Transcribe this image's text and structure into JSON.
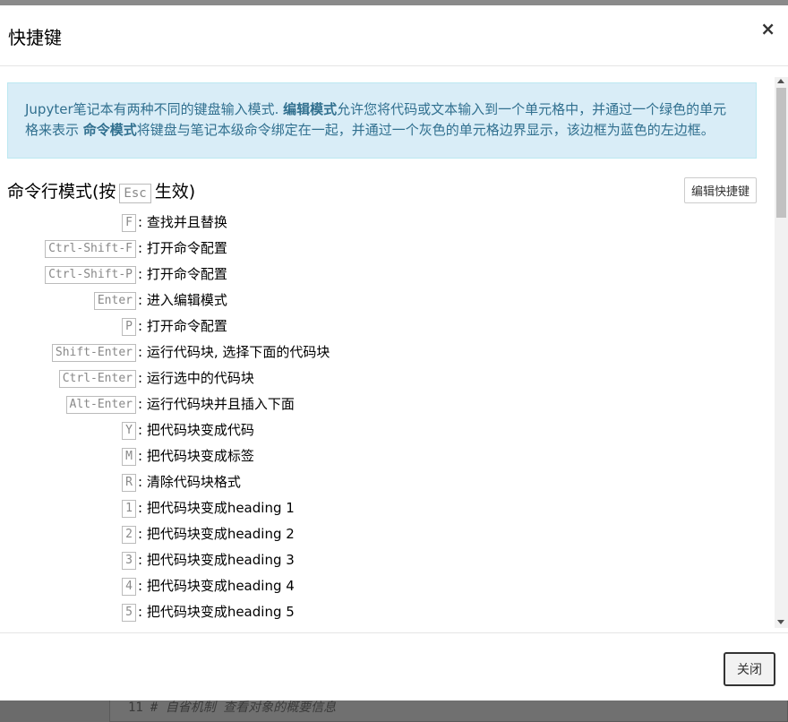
{
  "background": {
    "cell_number": "11",
    "cell_text": "# 自省机制 查看对象的概要信息"
  },
  "modal": {
    "title": "快捷键",
    "close_symbol": "×",
    "info": {
      "part1": "Jupyter笔记本有两种不同的键盘输入模式. ",
      "edit_mode": "编辑模式",
      "part2": "允许您将代码或文本输入到一个单元格中，并通过一个绿色的单元格来表示 ",
      "command_mode": "命令模式",
      "part3": "将键盘与笔记本级命令绑定在一起，并通过一个灰色的单元格边界显示，该边框为蓝色的左边框。"
    },
    "section": {
      "title_prefix": "命令行模式(按",
      "title_key": "Esc",
      "title_suffix": "生效)",
      "edit_shortcuts_label": "编辑快捷键"
    },
    "shortcuts": [
      {
        "key": "F",
        "desc": ": 查找并且替换"
      },
      {
        "key": "Ctrl-Shift-F",
        "desc": ": 打开命令配置"
      },
      {
        "key": "Ctrl-Shift-P",
        "desc": ": 打开命令配置"
      },
      {
        "key": "Enter",
        "desc": ": 进入编辑模式"
      },
      {
        "key": "P",
        "desc": ": 打开命令配置"
      },
      {
        "key": "Shift-Enter",
        "desc": ": 运行代码块, 选择下面的代码块"
      },
      {
        "key": "Ctrl-Enter",
        "desc": ": 运行选中的代码块"
      },
      {
        "key": "Alt-Enter",
        "desc": ": 运行代码块并且插入下面"
      },
      {
        "key": "Y",
        "desc": ": 把代码块变成代码"
      },
      {
        "key": "M",
        "desc": ": 把代码块变成标签"
      },
      {
        "key": "R",
        "desc": ": 清除代码块格式"
      },
      {
        "key": "1",
        "desc": ": 把代码块变成heading 1"
      },
      {
        "key": "2",
        "desc": ": 把代码块变成heading 2"
      },
      {
        "key": "3",
        "desc": ": 把代码块变成heading 3"
      },
      {
        "key": "4",
        "desc": ": 把代码块变成heading 4"
      },
      {
        "key": "5",
        "desc": ": 把代码块变成heading 5"
      }
    ],
    "footer": {
      "close_label": "关闭"
    }
  }
}
